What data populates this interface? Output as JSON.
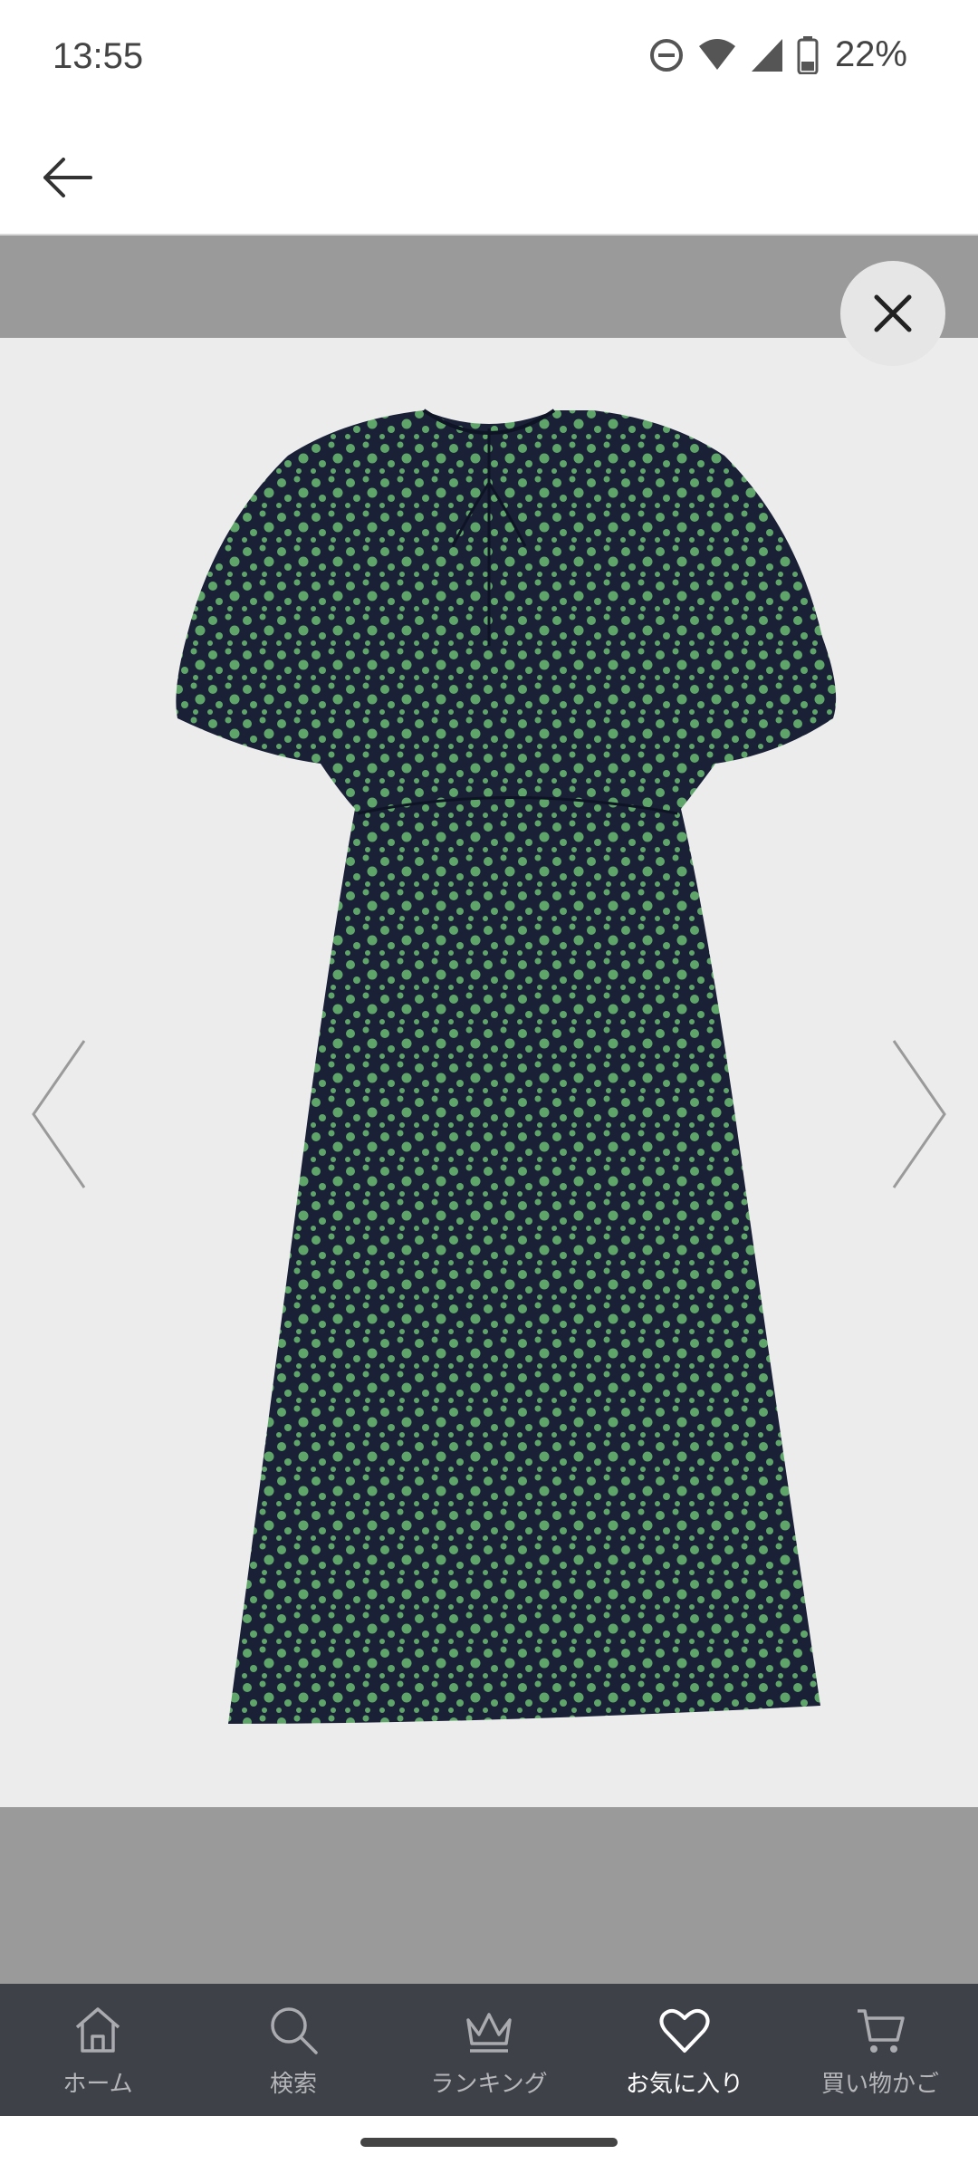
{
  "status_bar": {
    "time": "13:55",
    "battery": "22%",
    "icons": [
      "do-not-disturb-icon",
      "wifi-icon",
      "signal-icon",
      "battery-icon"
    ]
  },
  "header": {
    "back_icon": "arrow-left-icon"
  },
  "gallery": {
    "close_icon": "close-icon",
    "prev_icon": "chevron-left-icon",
    "next_icon": "chevron-right-icon",
    "image": "product-dress-photo",
    "colors": {
      "overlay": "#9a9a9a",
      "photo_bg": "#ececec",
      "dress_navy": "#1a2036",
      "dress_dots": "#5fa56a"
    }
  },
  "bottom_nav": {
    "items": [
      {
        "label": "ホーム",
        "icon": "home-icon",
        "active": false
      },
      {
        "label": "検索",
        "icon": "search-icon",
        "active": false
      },
      {
        "label": "ランキング",
        "icon": "crown-icon",
        "active": false
      },
      {
        "label": "お気に入り",
        "icon": "heart-icon",
        "active": true
      },
      {
        "label": "買い物かご",
        "icon": "cart-icon",
        "active": false
      }
    ],
    "colors": {
      "background": "#3f4148",
      "active": "#ffffff",
      "inactive": "#b4b6ba"
    }
  }
}
